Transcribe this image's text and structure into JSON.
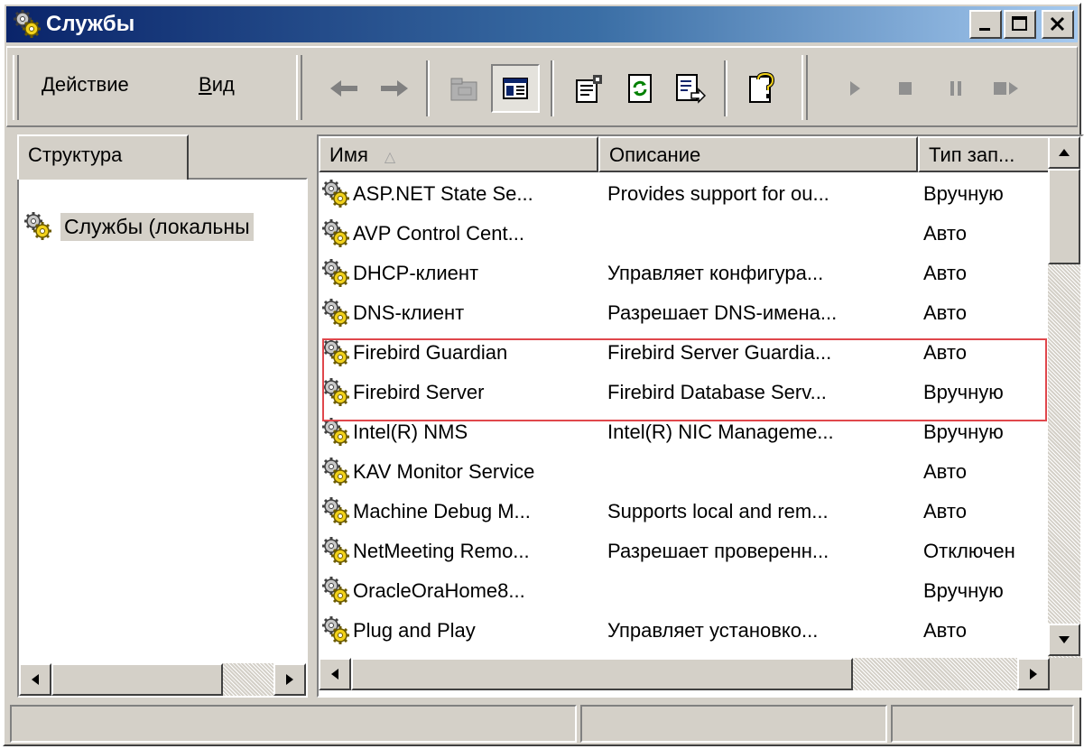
{
  "window": {
    "title": "Службы",
    "icon": "services-gear-icon"
  },
  "title_buttons": {
    "minimize": "minimize-icon",
    "maximize": "maximize-icon",
    "close": "close-icon"
  },
  "menu": {
    "action": "Действие",
    "action_underline": "Д",
    "action_rest": "ействие",
    "view": "Вид",
    "view_underline": "В",
    "view_rest": "ид"
  },
  "toolbar": {
    "icons": [
      "back-arrow-icon",
      "forward-arrow-icon",
      "up-folder-icon",
      "show-hide-tree-icon",
      "properties-icon",
      "refresh-icon",
      "export-list-icon",
      "help-icon",
      "start-service-icon",
      "stop-service-icon",
      "pause-service-icon",
      "restart-service-icon"
    ]
  },
  "tree": {
    "tab_label": "Структура",
    "root_label": "Службы (локальны"
  },
  "list": {
    "columns": {
      "name": "Имя",
      "description": "Описание",
      "startup_type": "Тип зап..."
    },
    "rows": [
      {
        "name": "ASP.NET State Se...",
        "description": "Provides support for ou...",
        "startup": "Вручную"
      },
      {
        "name": "AVP Control Cent...",
        "description": "",
        "startup": "Авто"
      },
      {
        "name": "DHCP-клиент",
        "description": "Управляет конфигура...",
        "startup": "Авто"
      },
      {
        "name": "DNS-клиент",
        "description": "Разрешает DNS-имена...",
        "startup": "Авто"
      },
      {
        "name": "Firebird Guardian",
        "description": "Firebird Server Guardia...",
        "startup": "Авто"
      },
      {
        "name": "Firebird Server",
        "description": "Firebird Database Serv...",
        "startup": "Вручную"
      },
      {
        "name": "Intel(R) NMS",
        "description": "Intel(R) NIC Manageme...",
        "startup": "Вручную"
      },
      {
        "name": "KAV Monitor Service",
        "description": "",
        "startup": "Авто"
      },
      {
        "name": "Machine Debug M...",
        "description": "Supports local and rem...",
        "startup": "Авто"
      },
      {
        "name": "NetMeeting Remo...",
        "description": "Разрешает проверенн...",
        "startup": "Отключен"
      },
      {
        "name": "OracleOraHome8...",
        "description": "",
        "startup": "Вручную"
      },
      {
        "name": "Plug and Play",
        "description": "Управляет установко...",
        "startup": "Авто"
      }
    ]
  },
  "colors": {
    "highlight_box": "#e0474c",
    "title_gradient_start": "#0a246a",
    "title_gradient_end": "#a6caf0"
  }
}
